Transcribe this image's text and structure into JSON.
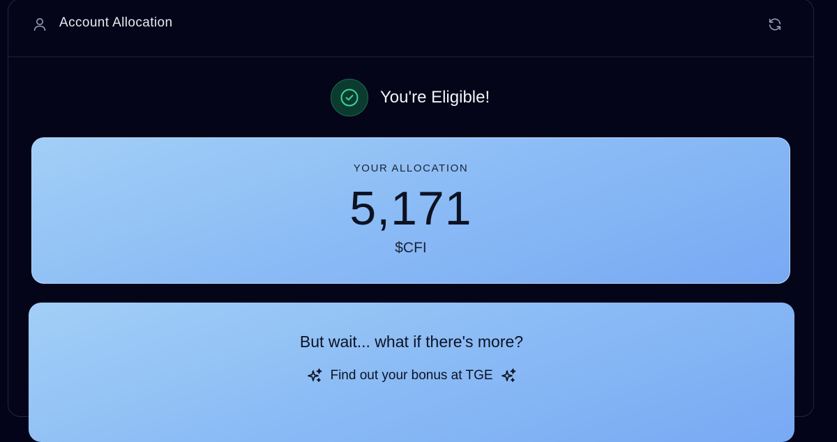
{
  "header": {
    "title": "Account Allocation",
    "user_icon": "user-icon",
    "refresh_icon": "refresh-icon"
  },
  "eligibility": {
    "text": "You're Eligible!",
    "icon": "check-circle-icon",
    "color": "#3fd39a"
  },
  "allocation": {
    "label": "YOUR ALLOCATION",
    "amount": "5,171",
    "token": "$CFI"
  },
  "bonus": {
    "title": "But wait... what if there's more?",
    "text": "Find out your bonus at TGE",
    "icon": "sparkles-icon"
  },
  "colors": {
    "background": "#03041a",
    "card_gradient_start": "#a2cff6",
    "card_gradient_end": "#78a9f4"
  }
}
